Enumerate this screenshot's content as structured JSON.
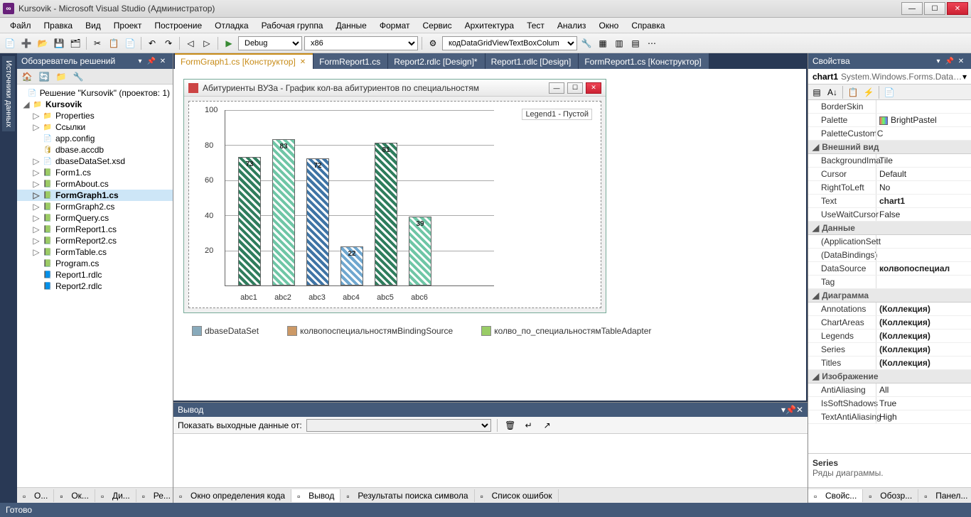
{
  "title": "Kursovik - Microsoft Visual Studio (Администратор)",
  "menu": [
    "Файл",
    "Правка",
    "Вид",
    "Проект",
    "Построение",
    "Отладка",
    "Рабочая группа",
    "Данные",
    "Формат",
    "Сервис",
    "Архитектура",
    "Тест",
    "Анализ",
    "Окно",
    "Справка"
  ],
  "toolbar_combos": {
    "config": "Debug",
    "platform": "x86",
    "search": "кодDataGridViewTextBoxColum"
  },
  "left_dock": [
    "Источники данных"
  ],
  "solution": {
    "title": "Обозреватель решений",
    "root": "Решение \"Kursovik\"  (проектов: 1)",
    "project": "Kursovik",
    "items": [
      {
        "icon": "folder",
        "label": "Properties",
        "chev": "▷"
      },
      {
        "icon": "folder",
        "label": "Ссылки",
        "chev": "▷"
      },
      {
        "icon": "file",
        "label": "app.config",
        "chev": ""
      },
      {
        "icon": "db",
        "label": "dbase.accdb",
        "chev": ""
      },
      {
        "icon": "file",
        "label": "dbaseDataSet.xsd",
        "chev": "▷"
      },
      {
        "icon": "cs",
        "label": "Form1.cs",
        "chev": "▷"
      },
      {
        "icon": "cs",
        "label": "FormAbout.cs",
        "chev": "▷"
      },
      {
        "icon": "cs",
        "label": "FormGraph1.cs",
        "chev": "▷",
        "sel": true
      },
      {
        "icon": "cs",
        "label": "FormGraph2.cs",
        "chev": "▷"
      },
      {
        "icon": "cs",
        "label": "FormQuery.cs",
        "chev": "▷"
      },
      {
        "icon": "cs",
        "label": "FormReport1.cs",
        "chev": "▷"
      },
      {
        "icon": "cs",
        "label": "FormReport2.cs",
        "chev": "▷"
      },
      {
        "icon": "cs",
        "label": "FormTable.cs",
        "chev": "▷"
      },
      {
        "icon": "cs",
        "label": "Program.cs",
        "chev": ""
      },
      {
        "icon": "rdlc",
        "label": "Report1.rdlc",
        "chev": ""
      },
      {
        "icon": "rdlc",
        "label": "Report2.rdlc",
        "chev": ""
      }
    ]
  },
  "tabs": [
    {
      "label": "FormGraph1.cs [Конструктор]",
      "active": true,
      "close": true
    },
    {
      "label": "FormReport1.cs"
    },
    {
      "label": "Report2.rdlc [Design]*"
    },
    {
      "label": "Report1.rdlc [Design]"
    },
    {
      "label": "FormReport1.cs [Конструктор]"
    }
  ],
  "form_window_title": "Абитуриенты ВУЗа - График кол-ва абитуриентов по специальностям",
  "chart_data": {
    "type": "bar",
    "categories": [
      "abc1",
      "abc2",
      "abc3",
      "abc4",
      "abc5",
      "abc6"
    ],
    "values": [
      73,
      83,
      72,
      22,
      81,
      39
    ],
    "ylim": [
      0,
      100
    ],
    "yticks": [
      20,
      40,
      60,
      80,
      100
    ],
    "legend": "Legend1 - Пустой",
    "colors": [
      "#2f7d5d",
      "#6fc6a6",
      "#3f74a5",
      "#6fa7cf",
      "#2f7d5d",
      "#6fc6a6"
    ]
  },
  "tray": [
    {
      "icon": "#8ab",
      "label": "dbaseDataSet"
    },
    {
      "icon": "#c96",
      "label": "колвопоспециальностямBindingSource"
    },
    {
      "icon": "#9c6",
      "label": "колво_по_специальностямTableAdapter"
    }
  ],
  "output": {
    "title": "Вывод",
    "label": "Показать выходные данные от:"
  },
  "properties": {
    "title": "Свойства",
    "obj_name": "chart1",
    "obj_type": "System.Windows.Forms.DataVis",
    "groups": [
      {
        "cat": "",
        "rows": [
          {
            "k": "BorderSkin",
            "v": ""
          },
          {
            "k": "Palette",
            "v": "BrightPastel",
            "swatch": true
          },
          {
            "k": "PaletteCustomC",
            "v": ""
          }
        ]
      },
      {
        "cat": "Внешний вид",
        "rows": [
          {
            "k": "BackgroundIma",
            "v": "Tile"
          },
          {
            "k": "Cursor",
            "v": "Default"
          },
          {
            "k": "RightToLeft",
            "v": "No"
          },
          {
            "k": "Text",
            "v": "chart1",
            "bold": true
          },
          {
            "k": "UseWaitCursor",
            "v": "False"
          }
        ]
      },
      {
        "cat": "Данные",
        "rows": [
          {
            "k": "(ApplicationSett",
            "v": ""
          },
          {
            "k": "(DataBindings)",
            "v": ""
          },
          {
            "k": "DataSource",
            "v": "колвопоспециал",
            "bold": true
          },
          {
            "k": "Tag",
            "v": ""
          }
        ]
      },
      {
        "cat": "Диаграмма",
        "rows": [
          {
            "k": "Annotations",
            "v": "(Коллекция)",
            "bold": true
          },
          {
            "k": "ChartAreas",
            "v": "(Коллекция)",
            "bold": true
          },
          {
            "k": "Legends",
            "v": "(Коллекция)",
            "bold": true
          },
          {
            "k": "Series",
            "v": "(Коллекция)",
            "bold": true
          },
          {
            "k": "Titles",
            "v": "(Коллекция)",
            "bold": true
          }
        ]
      },
      {
        "cat": "Изображение",
        "rows": [
          {
            "k": "AntiAliasing",
            "v": "All"
          },
          {
            "k": "IsSoftShadows",
            "v": "True"
          },
          {
            "k": "TextAntiAliasing",
            "v": "High"
          }
        ]
      }
    ],
    "desc_title": "Series",
    "desc_text": "Ряды диаграммы."
  },
  "bottom_tabs_left": [
    {
      "label": "О..."
    },
    {
      "label": "Ок..."
    },
    {
      "label": "Ди..."
    },
    {
      "label": "Ре..."
    }
  ],
  "bottom_tabs_center": [
    {
      "label": "Окно определения кода"
    },
    {
      "label": "Вывод",
      "active": true
    },
    {
      "label": "Результаты поиска символа"
    },
    {
      "label": "Список ошибок"
    }
  ],
  "bottom_tabs_right": [
    {
      "label": "Свойс...",
      "active": true
    },
    {
      "label": "Обозр..."
    },
    {
      "label": "Панел..."
    }
  ],
  "status": "Готово"
}
